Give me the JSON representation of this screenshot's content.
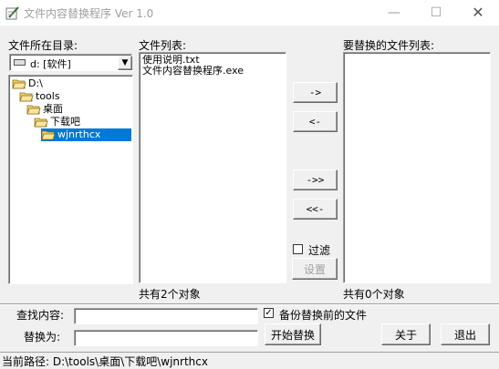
{
  "window": {
    "title": "文件内容替换程序 Ver 1.0",
    "minimize_glyph": "—",
    "maximize_glyph": "☐",
    "close_glyph": "✕"
  },
  "left_panel": {
    "label": "文件所在目录:",
    "drive": "d: [软件]",
    "tree": [
      {
        "label": "D:\\",
        "indent": 0,
        "open": true,
        "selected": false
      },
      {
        "label": "tools",
        "indent": 1,
        "open": true,
        "selected": false
      },
      {
        "label": "桌面",
        "indent": 2,
        "open": true,
        "selected": false
      },
      {
        "label": "下载吧",
        "indent": 3,
        "open": true,
        "selected": false
      },
      {
        "label": "wjnrthcx",
        "indent": 4,
        "open": true,
        "selected": true
      }
    ]
  },
  "file_list": {
    "label": "文件列表:",
    "items": [
      "使用说明.txt",
      "文件内容替换程序.exe"
    ],
    "count_text": "共有2个对象"
  },
  "replace_list": {
    "label": "要替换的文件列表:",
    "items": [],
    "count_text": "共有0个对象"
  },
  "transfer_buttons": {
    "add": "->",
    "remove": "<-",
    "add_all": "->>",
    "remove_all": "<<-"
  },
  "filter": {
    "label": "过滤",
    "checked": false,
    "settings_button": "设置"
  },
  "search": {
    "find_label": "查找内容:",
    "find_value": "",
    "replace_label": "替换为:",
    "replace_value": ""
  },
  "backup": {
    "label": "备份替换前的文件",
    "checked": true,
    "check_glyph": "✓"
  },
  "actions": {
    "start": "开始替换",
    "about": "关于",
    "exit": "退出"
  },
  "status": {
    "text": "当前路径: D:\\tools\\桌面\\下载吧\\wjnrthcx"
  },
  "colors": {
    "selection": "#0078d7",
    "folder": "#f4d06a"
  }
}
